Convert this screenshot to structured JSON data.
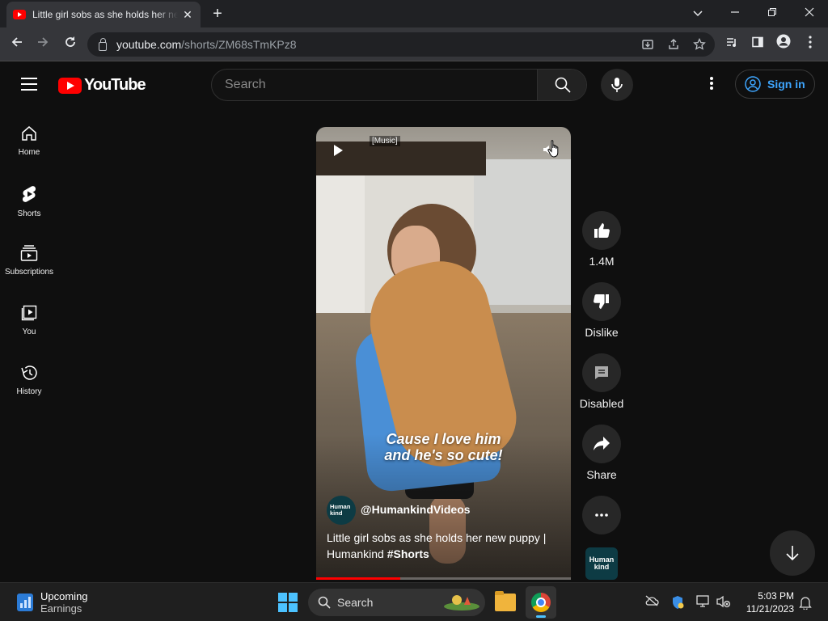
{
  "browser": {
    "tab_title": "Little girl sobs as she holds her new puppy | Humankind #Shorts - YouTube",
    "url_host": "youtube.com",
    "url_path": "/shorts/ZM68sTmKPz8"
  },
  "header": {
    "logo_text": "YouTube",
    "search_placeholder": "Search",
    "signin_label": "Sign in"
  },
  "sidebar": {
    "items": [
      {
        "label": "Home",
        "icon": "home-icon"
      },
      {
        "label": "Shorts",
        "icon": "shorts-icon"
      },
      {
        "label": "Subscriptions",
        "icon": "subscriptions-icon"
      },
      {
        "label": "You",
        "icon": "you-icon"
      },
      {
        "label": "History",
        "icon": "history-icon"
      }
    ]
  },
  "video": {
    "music_tag": "[Music]",
    "caption_line1": "Cause I love him",
    "caption_line2": "and he's so cute!",
    "channel_handle": "@HumankindVideos",
    "channel_avatar_text": "Human kind",
    "title_main": "Little girl sobs as she holds her new puppy | Humankind ",
    "title_tag": "#Shorts",
    "progress": 0.33
  },
  "actions": {
    "like_count": "1.4M",
    "dislike_label": "Dislike",
    "comments_label": "Disabled",
    "share_label": "Share",
    "channel_thumb_text": "Human kind"
  },
  "taskbar": {
    "weather_title": "Upcoming",
    "weather_sub": "Earnings",
    "search_label": "Search",
    "time": "5:03 PM",
    "date": "11/21/2023"
  },
  "colors": {
    "accent_red": "#ff0000",
    "link_blue": "#3ea6ff",
    "background": "#0f0f0f"
  }
}
